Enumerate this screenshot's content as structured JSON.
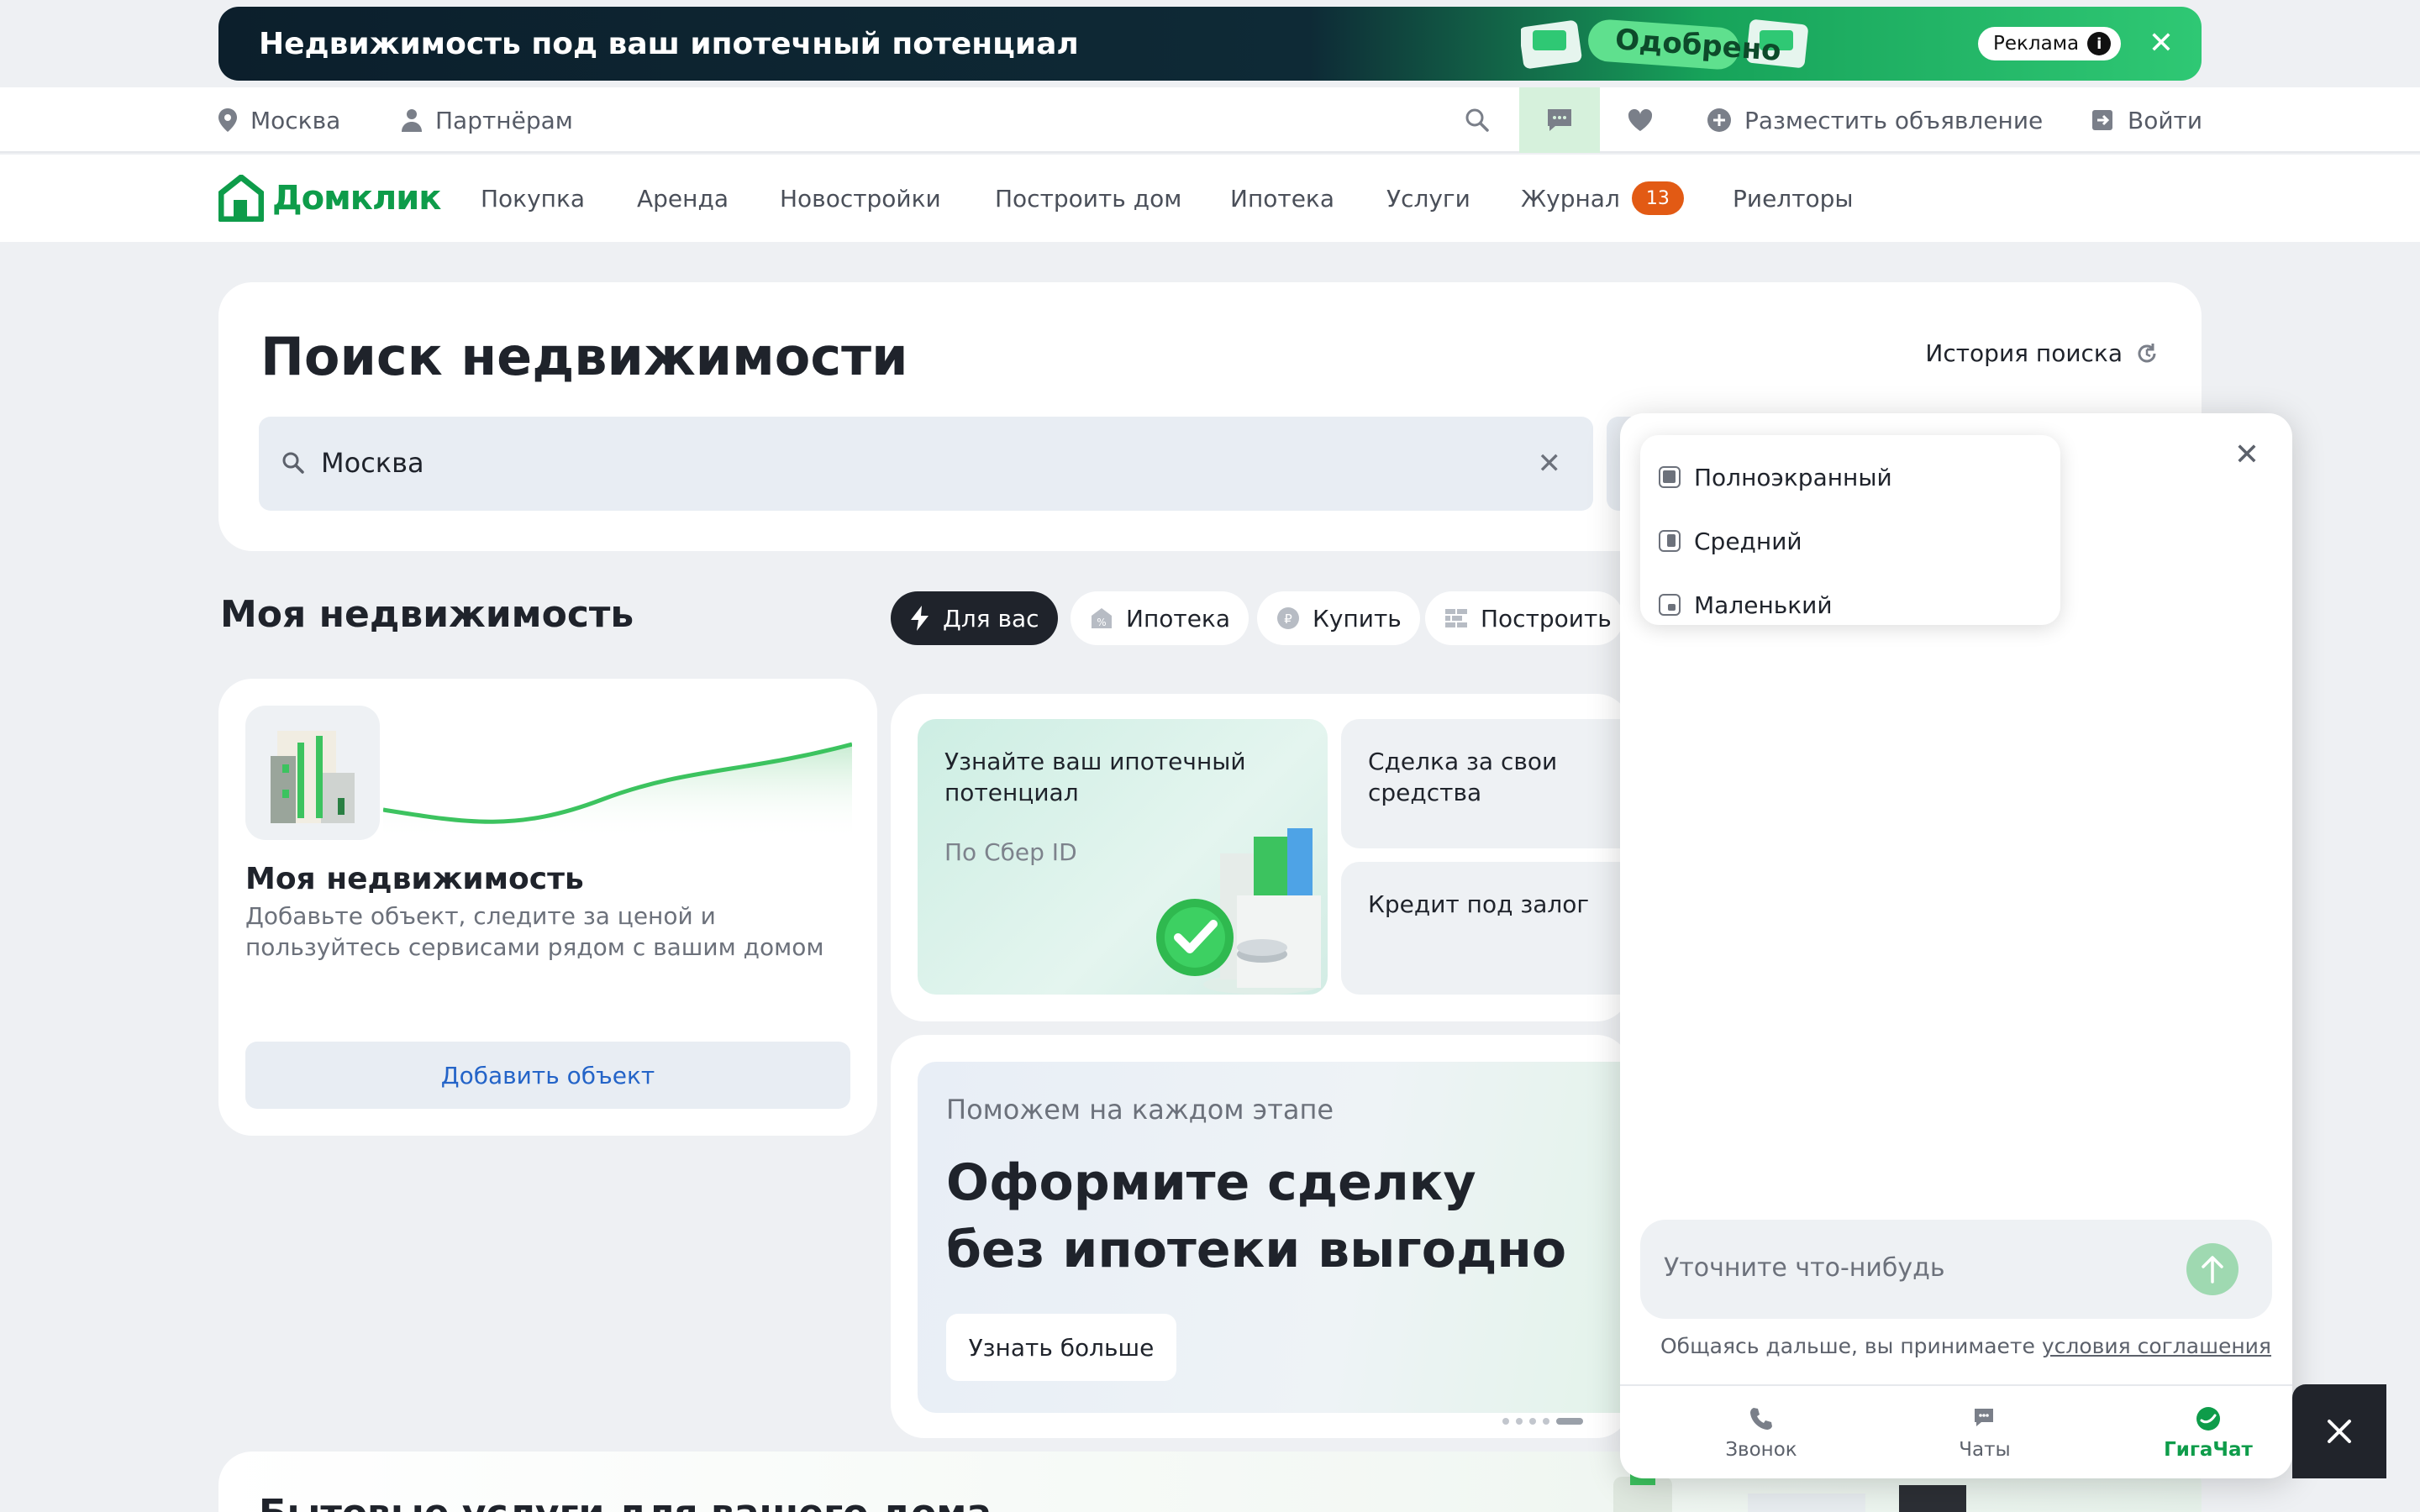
{
  "ad": {
    "title": "Недвижимость под ваш ипотечный потенциал",
    "badge": "Одобрено",
    "label": "Реклама",
    "info": "i",
    "close": "✕"
  },
  "topbar": {
    "city": "Москва",
    "partners": "Партнёрам",
    "post_ad": "Разместить объявление",
    "login": "Войти"
  },
  "nav": {
    "logo": "Домклик",
    "items": [
      "Покупка",
      "Аренда",
      "Новостройки",
      "Построить дом",
      "Ипотека",
      "Услуги",
      "Журнал",
      "Риелторы"
    ],
    "journal_badge": "13"
  },
  "search": {
    "title": "Поиск недвижимости",
    "history": "История поиска",
    "value": "Москва",
    "clear": "✕"
  },
  "my_property": {
    "heading": "Моя недвижимость",
    "chips": [
      "Для вас",
      "Ипотека",
      "Купить",
      "Построить"
    ],
    "card_title": "Моя недвижимость",
    "card_desc": "Добавьте объект, следите за ценой и пользуйтесь сервисами рядом с вашим домом",
    "add_button": "Добавить объект"
  },
  "promos": {
    "p1_title": "Узнайте ваш ипотечный потенциал",
    "p1_sub": "По Сбер ID",
    "p2_title": "Сделка за свои средства",
    "p3_title": "Кредит под залог"
  },
  "deal": {
    "sub": "Поможем на каждом этапе",
    "title_line1": "Оформите сделку",
    "title_line2": "без ипотеки выгодно",
    "button": "Узнать больше"
  },
  "bottom": {
    "title": "Бытовые услуги для вашего дома"
  },
  "chat": {
    "close": "✕",
    "sizes": [
      "Полноэкранный",
      "Средний",
      "Маленький"
    ],
    "placeholder": "Уточните что-нибудь",
    "agree_text": "Общаясь дальше, вы принимаете ",
    "agree_link": "условия соглашения",
    "tabs": [
      "Звонок",
      "Чаты",
      "ГигаЧат"
    ],
    "active_tab": "ГигаЧат"
  },
  "colors": {
    "brand": "#0e9c4a",
    "badge": "#e25a14",
    "dark": "#1f232b"
  }
}
